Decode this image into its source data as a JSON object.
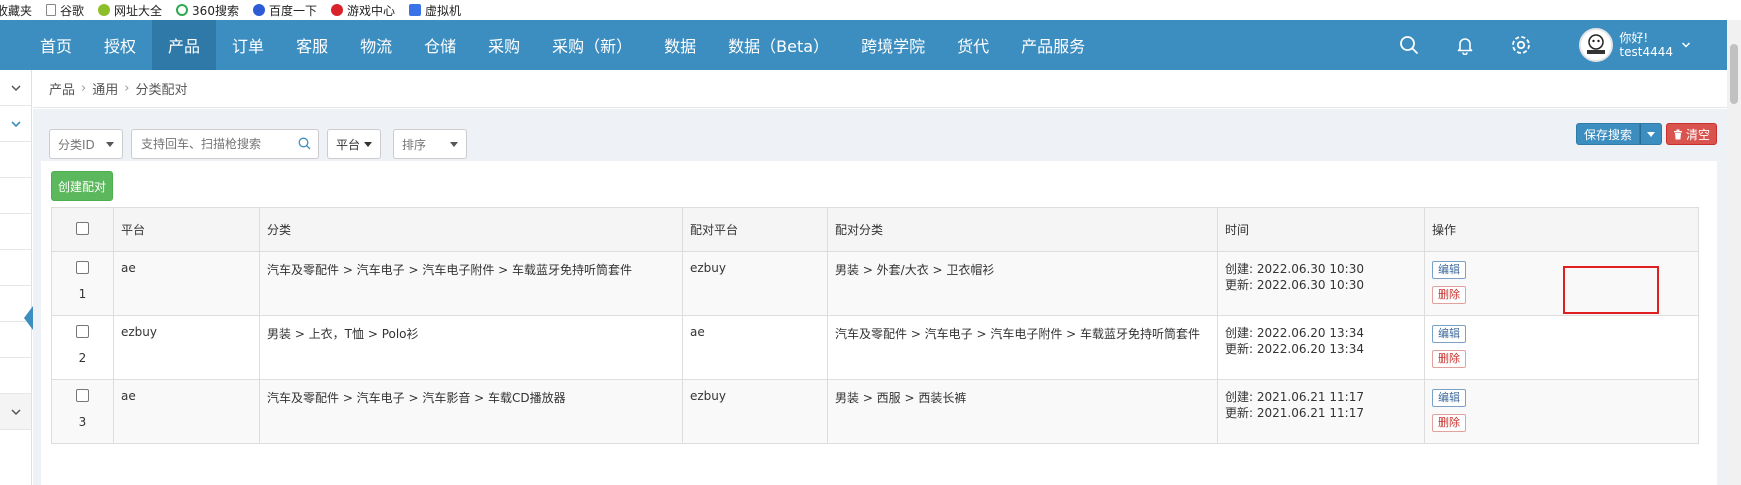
{
  "bookmarks": [
    {
      "label": "收藏夹",
      "icon": "none"
    },
    {
      "label": "谷歌",
      "icon": "doc-icon"
    },
    {
      "label": "网址大全",
      "icon": "green-globe-icon"
    },
    {
      "label": "360搜索",
      "icon": "360-icon"
    },
    {
      "label": "百度一下",
      "icon": "paw-icon"
    },
    {
      "label": "游戏中心",
      "icon": "game-icon"
    },
    {
      "label": "虚拟机",
      "icon": "blue-doc-icon"
    }
  ],
  "nav": {
    "items": [
      "首页",
      "授权",
      "产品",
      "订单",
      "客服",
      "物流",
      "仓储",
      "采购",
      "采购（新）",
      "数据",
      "数据（Beta）",
      "跨境学院",
      "货代",
      "产品服务"
    ],
    "active_index": 2,
    "user": {
      "greeting": "你好!",
      "name": "test4444"
    }
  },
  "breadcrumb": [
    "产品",
    "通用",
    "分类配对"
  ],
  "filters": {
    "category_id": "分类ID",
    "search_placeholder": "支持回车、扫描枪搜索",
    "platform": "平台",
    "sort": "排序"
  },
  "buttons": {
    "save_search": "保存搜索",
    "clear": "清空",
    "create": "创建配对"
  },
  "table": {
    "headers": [
      "平台",
      "分类",
      "配对平台",
      "配对分类",
      "时间",
      "操作"
    ],
    "rows": [
      {
        "index": "1",
        "platform": "ae",
        "category": "汽车及零配件 > 汽车电子 > 汽车电子附件 > 车载蓝牙免持听筒套件",
        "match_platform": "ezbuy",
        "match_category": "男装 > 外套/大衣 > 卫衣帽衫",
        "created": "创建: 2022.06.30 10:30",
        "updated": "更新: 2022.06.30 10:30",
        "edit": "编辑",
        "delete": "删除"
      },
      {
        "index": "2",
        "platform": "ezbuy",
        "category": "男装 > 上衣，T恤 > Polo衫",
        "match_platform": "ae",
        "match_category": "汽车及零配件 > 汽车电子 > 汽车电子附件 > 车载蓝牙免持听筒套件",
        "created": "创建: 2022.06.20 13:34",
        "updated": "更新: 2022.06.20 13:34",
        "edit": "编辑",
        "delete": "删除"
      },
      {
        "index": "3",
        "platform": "ae",
        "category": "汽车及零配件 > 汽车电子 > 汽车影音 > 车载CD播放器",
        "match_platform": "ezbuy",
        "match_category": "男装 > 西服 > 西装长裤",
        "created": "创建: 2021.06.21 11:17",
        "updated": "更新: 2021.06.21 11:17",
        "edit": "编辑",
        "delete": "删除"
      }
    ]
  },
  "colors": {
    "nav": "#3d8ec0",
    "nav_active": "#2f79a8",
    "success": "#5cb85c",
    "danger": "#d9534f",
    "highlight": "#e02020"
  }
}
